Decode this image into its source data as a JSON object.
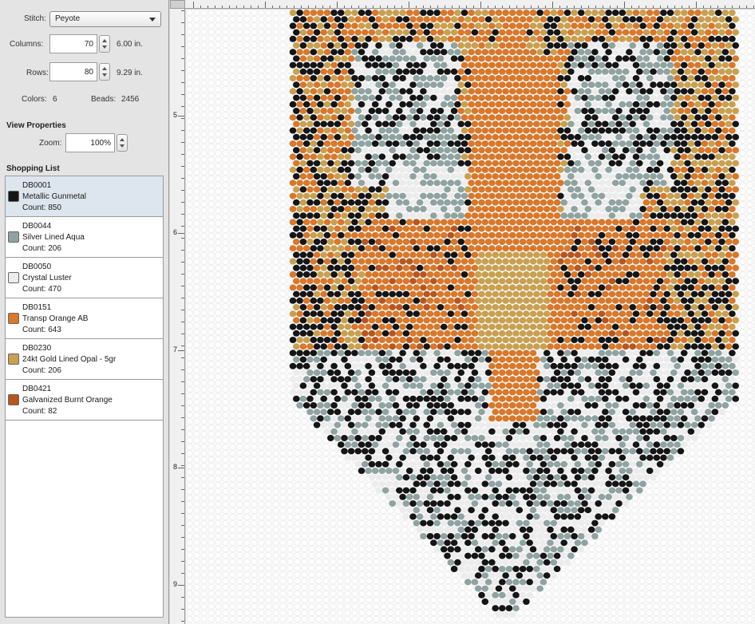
{
  "pattern_properties": {
    "stitch_label": "Stitch:",
    "stitch_value": "Peyote",
    "columns_label": "Columns:",
    "columns_value": "70",
    "columns_inches": "6.00 in.",
    "rows_label": "Rows:",
    "rows_value": "80",
    "rows_inches": "9.29 in.",
    "colors_label": "Colors:",
    "colors_value": "6",
    "beads_label": "Beads:",
    "beads_value": "2456"
  },
  "view_properties": {
    "title": "View Properties",
    "zoom_label": "Zoom:",
    "zoom_value": "100%"
  },
  "shopping_list": {
    "title": "Shopping List",
    "items": [
      {
        "code": "DB0001",
        "name": "Metallic Gunmetal",
        "count": "Count: 850",
        "color": "#151515"
      },
      {
        "code": "DB0044",
        "name": "Silver Lined Aqua",
        "count": "Count: 206",
        "color": "#8fa3a1"
      },
      {
        "code": "DB0050",
        "name": "Crystal Luster",
        "count": "Count: 470",
        "color": "#ececec"
      },
      {
        "code": "DB0151",
        "name": "Transp Orange AB",
        "count": "Count: 643",
        "color": "#d9782a"
      },
      {
        "code": "DB0230",
        "name": "24kt Gold Lined Opal - 5gr",
        "count": "Count: 206",
        "color": "#c9a04f"
      },
      {
        "code": "DB0421",
        "name": "Galvanized Burnt Orange",
        "count": "Count: 82",
        "color": "#b8561f"
      }
    ]
  },
  "ruler": {
    "left_labels": [
      "5",
      "6",
      "7",
      "8",
      "9"
    ]
  }
}
